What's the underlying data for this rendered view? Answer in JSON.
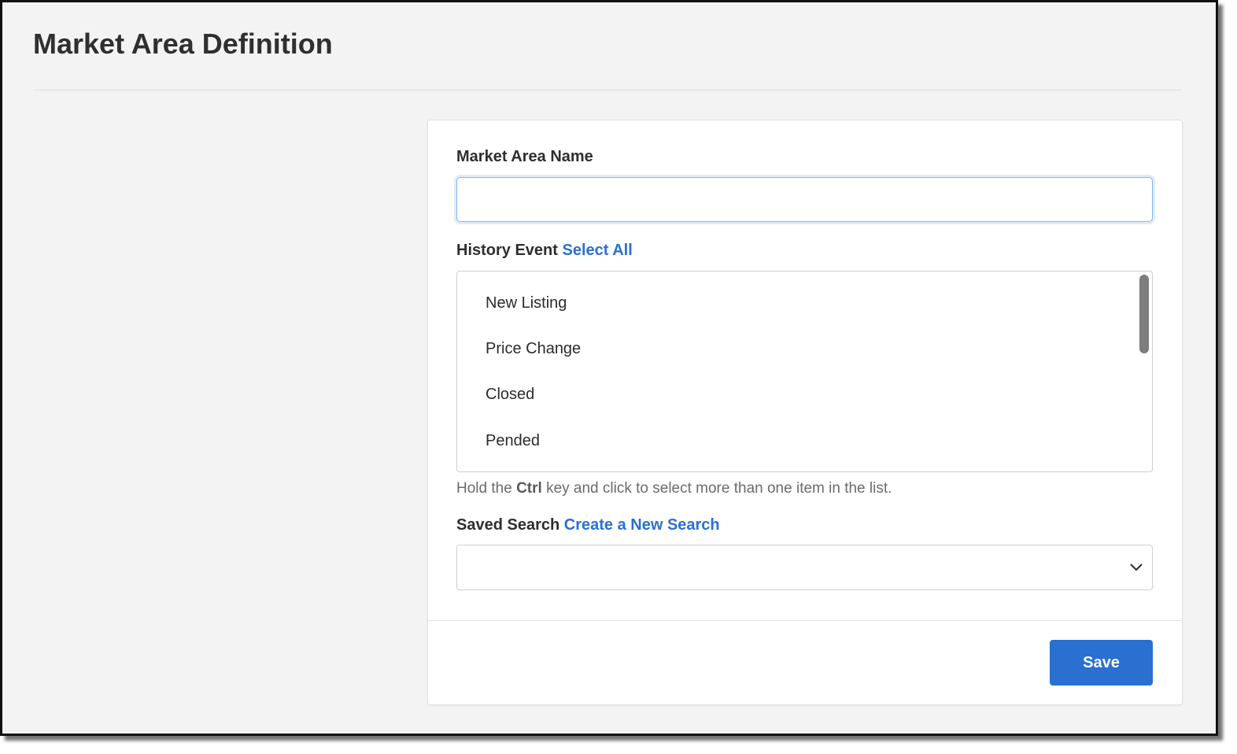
{
  "page": {
    "title": "Market Area Definition"
  },
  "form": {
    "name_label": "Market Area Name",
    "name_value": "",
    "history_label": "History Event",
    "select_all_label": "Select All",
    "history_options": [
      "New Listing",
      "Price Change",
      "Closed",
      "Pended"
    ],
    "help_prefix": "Hold the",
    "help_key": "Ctrl",
    "help_suffix": "key and click to select more than one item in the list.",
    "saved_search_label": "Saved Search",
    "create_search_label": "Create a New Search",
    "saved_search_value": ""
  },
  "actions": {
    "save_label": "Save"
  },
  "icons": {
    "dropdown": "chevron-down-icon"
  },
  "colors": {
    "accent": "#2a70d1",
    "background": "#f3f3f3",
    "card": "#ffffff"
  }
}
